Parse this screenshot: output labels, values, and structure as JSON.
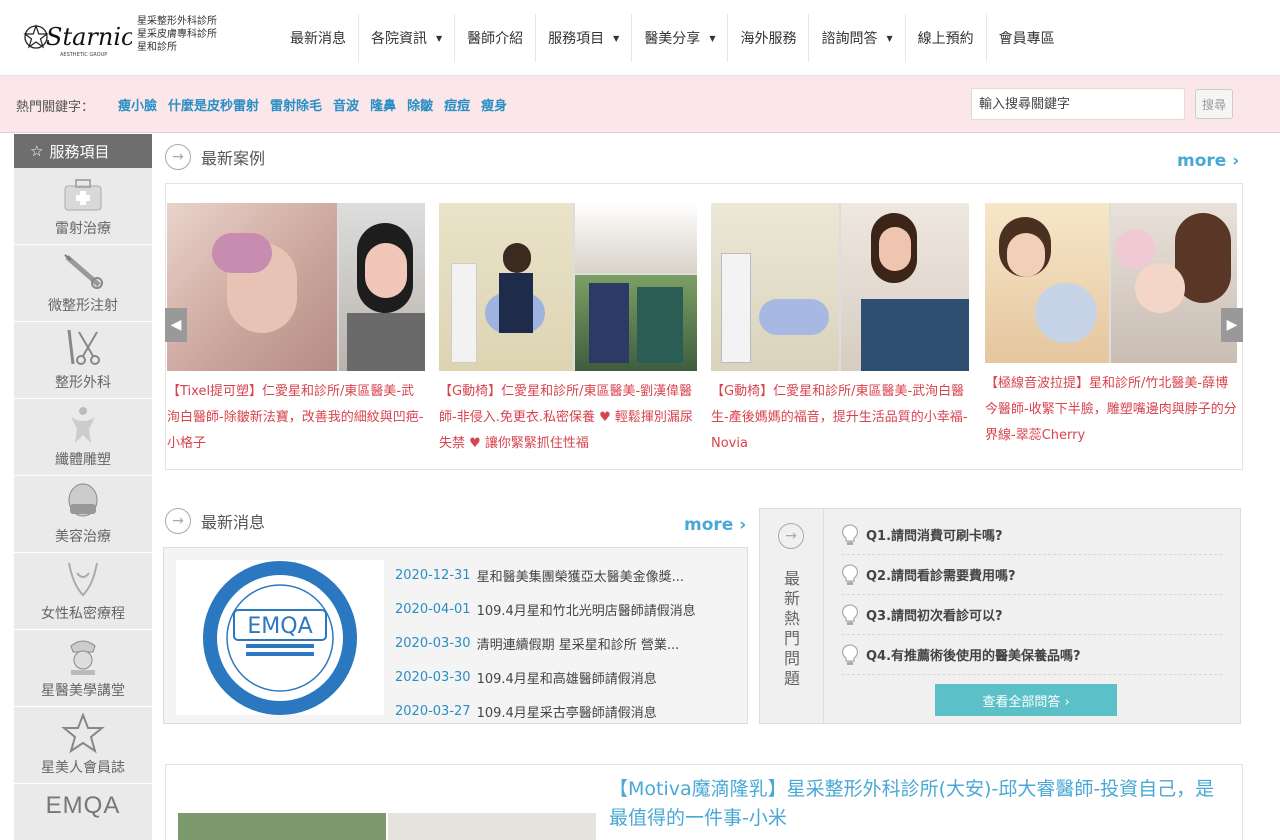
{
  "brand": {
    "logo_text": "Starnic",
    "logo_tagline": "AESTHETIC GROUP",
    "clinics": [
      "星采整形外科診所",
      "星采皮膚專科診所",
      "星和診所"
    ]
  },
  "nav": [
    {
      "label": "最新消息",
      "dropdown": false
    },
    {
      "label": "各院資訊",
      "dropdown": true
    },
    {
      "label": "醫師介紹",
      "dropdown": false
    },
    {
      "label": "服務項目",
      "dropdown": true
    },
    {
      "label": "醫美分享",
      "dropdown": true
    },
    {
      "label": "海外服務",
      "dropdown": false
    },
    {
      "label": "諮詢問答",
      "dropdown": true
    },
    {
      "label": "線上預約",
      "dropdown": false
    },
    {
      "label": "會員專區",
      "dropdown": false
    }
  ],
  "hotbar": {
    "label": "熱門關鍵字：",
    "keywords": [
      "瘦小臉",
      "什麼是皮秒雷射",
      "雷射除毛",
      "音波",
      "隆鼻",
      "除皺",
      "痘痘",
      "瘦身"
    ],
    "search_placeholder": "輸入搜尋關鍵字",
    "search_button": "搜尋"
  },
  "sidebar": {
    "title": "服務項目",
    "items": [
      {
        "label": "雷射治療",
        "icon": "medkit-icon"
      },
      {
        "label": "微整形注射",
        "icon": "syringe-icon"
      },
      {
        "label": "整形外科",
        "icon": "scissors-icon"
      },
      {
        "label": "纖體雕塑",
        "icon": "body-icon"
      },
      {
        "label": "美容治療",
        "icon": "mask-icon"
      },
      {
        "label": "女性私密療程",
        "icon": "feminine-icon"
      },
      {
        "label": "星醫美學講堂",
        "icon": "nurse-icon"
      },
      {
        "label": "星美人會員誌",
        "icon": "star-icon"
      },
      {
        "label": "EMQA",
        "icon": "emqa-logo"
      }
    ]
  },
  "cases": {
    "title": "最新案例",
    "more": "more ›",
    "items": [
      {
        "text": "【Tixel提可塑】仁愛星和診所/東區醫美-武洵白醫師-除皺新法寶，改善我的細紋與凹疤-小格子"
      },
      {
        "text": "【G動椅】仁愛星和診所/東區醫美-劉漢偉醫師-非侵入.免更衣.私密保養 ♥ 輕鬆揮別漏尿失禁 ♥ 讓你緊緊抓住性福"
      },
      {
        "text": "【G動椅】仁愛星和診所/東區醫美-武洵白醫生-產後媽媽的福音，提升生活品質的小幸福-Novia"
      },
      {
        "text": "【極線音波拉提】星和診所/竹北醫美-薛博今醫師-收緊下半臉，雕塑嘴邊肉與脖子的分界線-翠蕊Cherry"
      }
    ]
  },
  "news": {
    "title": "最新消息",
    "more": "more ›",
    "logo_text": "EMQA",
    "items": [
      {
        "date": "2020-12-31",
        "title": "星和醫美集團榮獲亞太醫美金像獎..."
      },
      {
        "date": "2020-04-01",
        "title": "109.4月星和竹北光明店醫師請假消息"
      },
      {
        "date": "2020-03-30",
        "title": "清明連續假期 星采星和診所 營業..."
      },
      {
        "date": "2020-03-30",
        "title": "109.4月星和高雄醫師請假消息"
      },
      {
        "date": "2020-03-27",
        "title": "109.4月星采古亭醫師請假消息"
      }
    ]
  },
  "faq": {
    "side_title": "最新熱門問題",
    "items": [
      "Q1.請問消費可刷卡嗎?",
      "Q2.請問看診需要費用嗎?",
      "Q3.請問初次看診可以?",
      "Q4.有推薦術後使用的醫美保養品嗎?"
    ],
    "all_button": "查看全部問答 ›"
  },
  "article": {
    "title": "【Motiva魔滴隆乳】星采整形外科診所(大安)-邱大睿醫師-投資自己，是最值得的一件事-小米"
  },
  "colors": {
    "accent_blue": "#4aa8d6",
    "case_red": "#d8434e",
    "hotbar_pink": "#fbe6ea",
    "faq_teal": "#5bc0c8"
  }
}
